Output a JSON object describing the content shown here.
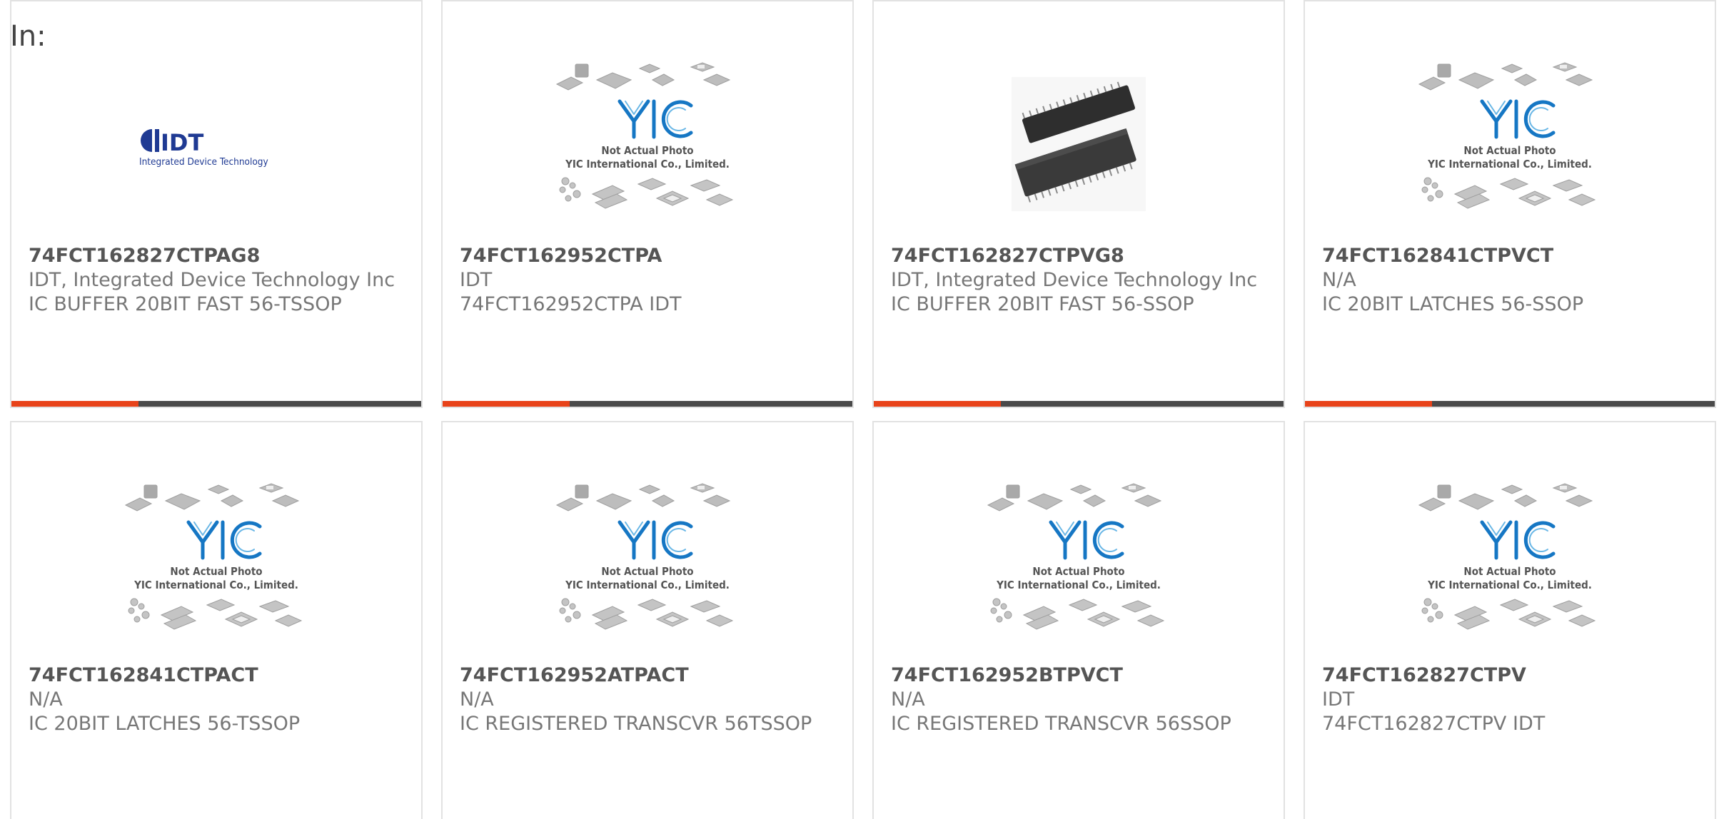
{
  "section_label": "In:",
  "placeholder": {
    "brand": "YIC",
    "line1": "Not Actual Photo",
    "line2": "YIC International Co., Limited."
  },
  "idt_logo": {
    "mark": "IDT",
    "tagline": "Integrated Device Technology",
    "color": "#1f3a93"
  },
  "accent_color": "#e8431a",
  "cards": [
    {
      "part_number": "74FCT162827CTPAG8",
      "manufacturer": "IDT, Integrated Device Technology Inc",
      "description": "IC BUFFER 20BIT FAST 56-TSSOP",
      "image": "idt-logo",
      "progress": 0.31
    },
    {
      "part_number": "74FCT162952CTPA",
      "manufacturer": "IDT",
      "description": "74FCT162952CTPA IDT",
      "image": "placeholder",
      "progress": 0.31
    },
    {
      "part_number": "74FCT162827CTPVG8",
      "manufacturer": "IDT, Integrated Device Technology Inc",
      "description": "IC BUFFER 20BIT FAST 56-SSOP",
      "image": "chip-photo",
      "progress": 0.31
    },
    {
      "part_number": "74FCT162841CTPVCT",
      "manufacturer": "N/A",
      "description": "IC 20BIT LATCHES 56-SSOP",
      "image": "placeholder",
      "progress": 0.31
    },
    {
      "part_number": "74FCT162841CTPACT",
      "manufacturer": "N/A",
      "description": "IC 20BIT LATCHES 56-TSSOP",
      "image": "placeholder"
    },
    {
      "part_number": "74FCT162952ATPACT",
      "manufacturer": "N/A",
      "description": "IC REGISTERED TRANSCVR 56TSSOP",
      "image": "placeholder"
    },
    {
      "part_number": "74FCT162952BTPVCT",
      "manufacturer": "N/A",
      "description": "IC REGISTERED TRANSCVR 56SSOP",
      "image": "placeholder"
    },
    {
      "part_number": "74FCT162827CTPV",
      "manufacturer": "IDT",
      "description": "74FCT162827CTPV IDT",
      "image": "placeholder"
    }
  ]
}
